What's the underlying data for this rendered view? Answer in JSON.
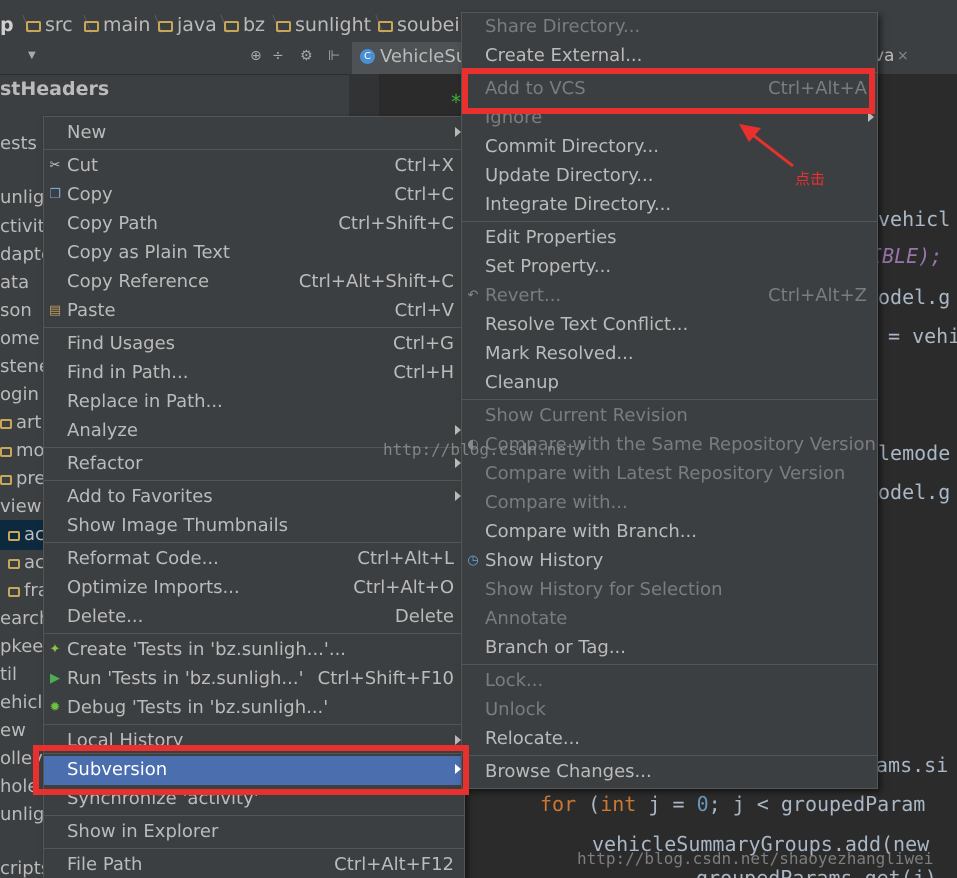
{
  "breadcrumbs": [
    {
      "label": "p",
      "icon": ""
    },
    {
      "label": "src",
      "icon": "folder-icon"
    },
    {
      "label": "main",
      "icon": "folder-icon"
    },
    {
      "label": "java",
      "icon": "folder-icon"
    },
    {
      "label": "bz",
      "icon": "folder-icon"
    },
    {
      "label": "sunlight",
      "icon": "folder-icon"
    },
    {
      "label": "soubei",
      "icon": "folder-icon"
    }
  ],
  "editor_tabs": [
    {
      "label": "VehicleSu",
      "active": true
    },
    {
      "label": "va",
      "active": false
    }
  ],
  "project_tree": [
    "stHeaders",
    "ests",
    "unlig",
    "ctivity",
    "dapte",
    "ata",
    "son",
    "ome",
    "stene",
    "ogin",
    "artbr",
    "moc",
    "pres",
    "view",
    "ac",
    "ac",
    "fra",
    "earch",
    "pkee",
    "til",
    "ehicle",
    "ew",
    "olley",
    "hole",
    "unlig",
    "cripts"
  ],
  "code_lines": [
    "*",
    "vehicl",
    "IBLE);",
    "odel.g",
    "= vehi",
    "lemode",
    "odel.g",
    "ams.si",
    "for (int j = 0; j < groupedParam",
    "vehicleSummaryGroups.add(new",
    "groupedParams.get(j)"
  ],
  "context_menu": {
    "items": [
      {
        "label": "New",
        "shortcut": "",
        "submenu": true
      },
      {
        "label": "Cut",
        "shortcut": "Ctrl+X",
        "icon": "scissors-icon"
      },
      {
        "label": "Copy",
        "shortcut": "Ctrl+C",
        "icon": "copy-icon"
      },
      {
        "label": "Copy Path",
        "shortcut": "Ctrl+Shift+C"
      },
      {
        "label": "Copy as Plain Text",
        "shortcut": ""
      },
      {
        "label": "Copy Reference",
        "shortcut": "Ctrl+Alt+Shift+C"
      },
      {
        "label": "Paste",
        "shortcut": "Ctrl+V",
        "icon": "paste-icon"
      },
      {
        "label": "Find Usages",
        "shortcut": "Ctrl+G"
      },
      {
        "label": "Find in Path...",
        "shortcut": "Ctrl+H"
      },
      {
        "label": "Replace in Path...",
        "shortcut": ""
      },
      {
        "label": "Analyze",
        "shortcut": "",
        "submenu": true
      },
      {
        "label": "Refactor",
        "shortcut": "",
        "submenu": true
      },
      {
        "label": "Add to Favorites",
        "shortcut": "",
        "submenu": true
      },
      {
        "label": "Show Image Thumbnails",
        "shortcut": ""
      },
      {
        "label": "Reformat Code...",
        "shortcut": "Ctrl+Alt+L"
      },
      {
        "label": "Optimize Imports...",
        "shortcut": "Ctrl+Alt+O"
      },
      {
        "label": "Delete...",
        "shortcut": "Delete"
      },
      {
        "label": "Create 'Tests in 'bz.sunligh...'...",
        "shortcut": "",
        "icon": "android-icon"
      },
      {
        "label": "Run 'Tests in 'bz.sunligh...'",
        "shortcut": "Ctrl+Shift+F10",
        "icon": "run-icon"
      },
      {
        "label": "Debug 'Tests in 'bz.sunligh...'",
        "shortcut": "",
        "icon": "debug-icon"
      },
      {
        "label": "Local History",
        "shortcut": "",
        "submenu": true
      },
      {
        "label": "Subversion",
        "shortcut": "",
        "submenu": true,
        "highlighted": true
      },
      {
        "label": "Synchronize 'activity'",
        "shortcut": ""
      },
      {
        "label": "Show in Explorer",
        "shortcut": ""
      },
      {
        "label": "File Path",
        "shortcut": "Ctrl+Alt+F12"
      }
    ]
  },
  "subversion_menu": {
    "items": [
      {
        "label": "Share Directory...",
        "shortcut": "",
        "disabled": true
      },
      {
        "label": "Create External...",
        "shortcut": ""
      },
      {
        "label": "Add to VCS",
        "shortcut": "Ctrl+Alt+A",
        "disabled": true
      },
      {
        "label": "Ignore",
        "shortcut": "",
        "disabled": true,
        "submenu": true
      },
      {
        "label": "Commit Directory...",
        "shortcut": ""
      },
      {
        "label": "Update Directory...",
        "shortcut": ""
      },
      {
        "label": "Integrate Directory...",
        "shortcut": ""
      },
      {
        "label": "Edit Properties",
        "shortcut": ""
      },
      {
        "label": "Set Property...",
        "shortcut": ""
      },
      {
        "label": "Revert...",
        "shortcut": "Ctrl+Alt+Z",
        "disabled": true,
        "icon": "revert-icon"
      },
      {
        "label": "Resolve Text Conflict...",
        "shortcut": ""
      },
      {
        "label": "Mark Resolved...",
        "shortcut": ""
      },
      {
        "label": "Cleanup",
        "shortcut": ""
      },
      {
        "label": "Show Current Revision",
        "shortcut": "",
        "disabled": true
      },
      {
        "label": "Compare with the Same Repository Version",
        "shortcut": "",
        "disabled": true,
        "icon": "compare-icon"
      },
      {
        "label": "Compare with Latest Repository Version",
        "shortcut": "",
        "disabled": true
      },
      {
        "label": "Compare with...",
        "shortcut": "",
        "disabled": true
      },
      {
        "label": "Compare with Branch...",
        "shortcut": ""
      },
      {
        "label": "Show History",
        "shortcut": "",
        "icon": "history-icon"
      },
      {
        "label": "Show History for Selection",
        "shortcut": "",
        "disabled": true
      },
      {
        "label": "Annotate",
        "shortcut": "",
        "disabled": true
      },
      {
        "label": "Branch or Tag...",
        "shortcut": ""
      },
      {
        "label": "Lock...",
        "shortcut": "",
        "disabled": true
      },
      {
        "label": "Unlock",
        "shortcut": "",
        "disabled": true
      },
      {
        "label": "Relocate...",
        "shortcut": ""
      },
      {
        "label": "Browse Changes...",
        "shortcut": ""
      }
    ]
  },
  "annotation_text": "点击",
  "watermarks": [
    "http://blog.csdn.net/",
    "http://blog.csdn.net/shaoyezhangliwei"
  ],
  "colors": {
    "highlight": "#4b6eaf",
    "annotation": "#e8312e",
    "menu_bg": "#3c3f41",
    "editor_bg": "#2b2b2b"
  }
}
